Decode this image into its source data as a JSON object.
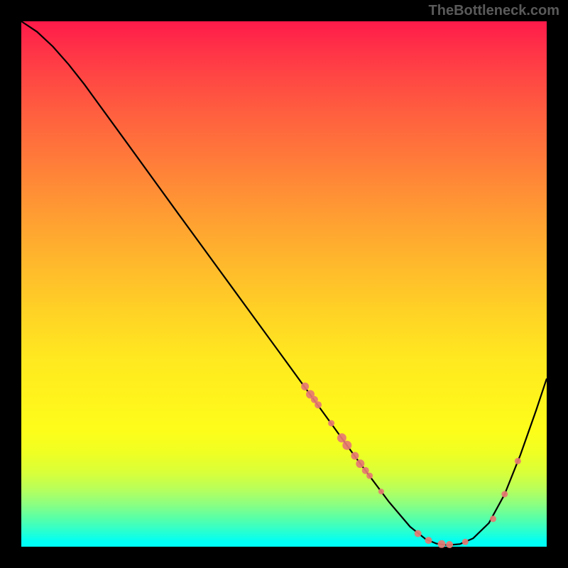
{
  "watermark": "TheBottleneck.com",
  "chart_data": {
    "type": "line",
    "title": "",
    "xlabel": "",
    "ylabel": "",
    "xlim": [
      0,
      100
    ],
    "ylim": [
      0,
      100
    ],
    "gradient_note": "vertical rainbow gradient from red (top, high y) to cyan/green (bottom, near y=0)",
    "curve": [
      {
        "x": 0.0,
        "y": 100.0
      },
      {
        "x": 3.0,
        "y": 98.0
      },
      {
        "x": 6.0,
        "y": 95.2
      },
      {
        "x": 9.0,
        "y": 91.8
      },
      {
        "x": 12.0,
        "y": 88.0
      },
      {
        "x": 20.0,
        "y": 77.0
      },
      {
        "x": 30.0,
        "y": 63.2
      },
      {
        "x": 40.0,
        "y": 49.5
      },
      {
        "x": 50.0,
        "y": 35.8
      },
      {
        "x": 58.0,
        "y": 24.8
      },
      {
        "x": 64.0,
        "y": 16.5
      },
      {
        "x": 70.0,
        "y": 8.5
      },
      {
        "x": 74.0,
        "y": 3.8
      },
      {
        "x": 77.0,
        "y": 1.4
      },
      {
        "x": 79.0,
        "y": 0.6
      },
      {
        "x": 81.0,
        "y": 0.3
      },
      {
        "x": 83.5,
        "y": 0.5
      },
      {
        "x": 86.0,
        "y": 1.6
      },
      {
        "x": 89.0,
        "y": 4.5
      },
      {
        "x": 92.0,
        "y": 10.0
      },
      {
        "x": 95.0,
        "y": 17.5
      },
      {
        "x": 98.0,
        "y": 26.0
      },
      {
        "x": 100.0,
        "y": 32.0
      }
    ],
    "points": [
      {
        "x": 54.0,
        "y": 30.5,
        "r": 5.5
      },
      {
        "x": 55.0,
        "y": 29.0,
        "r": 6.0
      },
      {
        "x": 55.8,
        "y": 28.0,
        "r": 5.0
      },
      {
        "x": 56.5,
        "y": 27.0,
        "r": 5.0
      },
      {
        "x": 59.0,
        "y": 23.5,
        "r": 4.5
      },
      {
        "x": 61.0,
        "y": 20.7,
        "r": 6.5
      },
      {
        "x": 62.0,
        "y": 19.3,
        "r": 6.5
      },
      {
        "x": 63.5,
        "y": 17.3,
        "r": 5.5
      },
      {
        "x": 64.5,
        "y": 15.8,
        "r": 6.0
      },
      {
        "x": 65.5,
        "y": 14.5,
        "r": 5.0
      },
      {
        "x": 66.3,
        "y": 13.5,
        "r": 4.5
      },
      {
        "x": 68.5,
        "y": 10.5,
        "r": 4.0
      },
      {
        "x": 75.5,
        "y": 2.5,
        "r": 5.0
      },
      {
        "x": 77.5,
        "y": 1.2,
        "r": 5.0
      },
      {
        "x": 80.0,
        "y": 0.5,
        "r": 5.5
      },
      {
        "x": 81.5,
        "y": 0.4,
        "r": 5.0
      },
      {
        "x": 84.5,
        "y": 0.9,
        "r": 4.5
      },
      {
        "x": 89.8,
        "y": 5.3,
        "r": 4.5
      },
      {
        "x": 92.0,
        "y": 10.0,
        "r": 4.5
      },
      {
        "x": 94.5,
        "y": 16.3,
        "r": 4.5
      }
    ]
  }
}
